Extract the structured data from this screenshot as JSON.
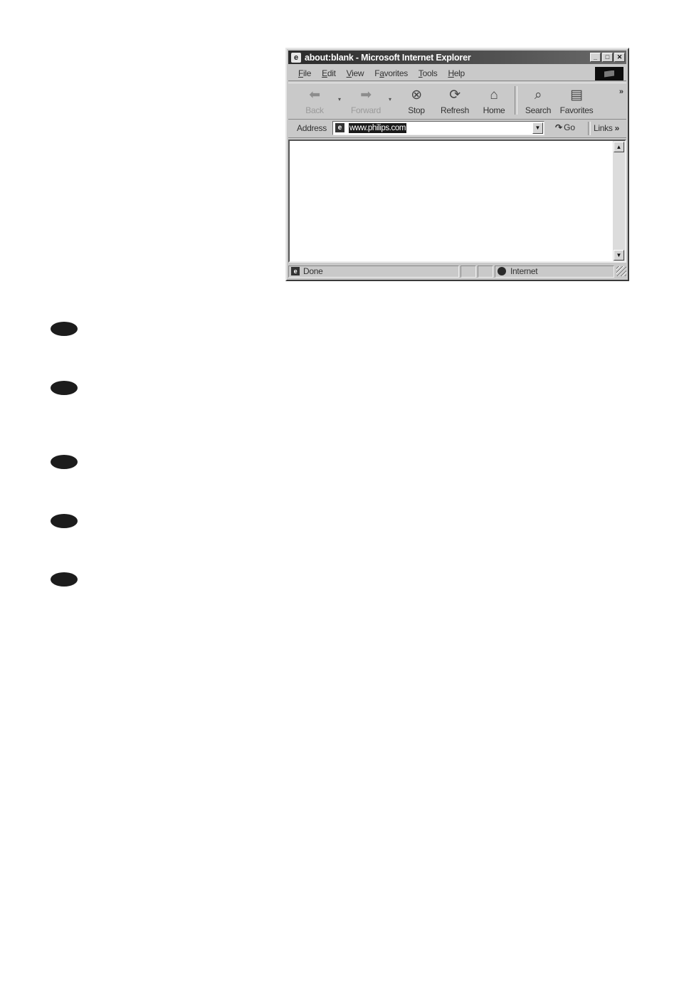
{
  "browser": {
    "title": "about:blank - Microsoft Internet Explorer",
    "title_icon": "e",
    "window_buttons": {
      "minimize": "_",
      "maximize": "□",
      "close": "✕"
    },
    "menu": [
      {
        "underlined": "F",
        "rest": "ile"
      },
      {
        "underlined": "E",
        "rest": "dit"
      },
      {
        "underlined": "V",
        "rest": "iew"
      },
      {
        "prefix": "F",
        "underlined": "a",
        "rest": "vorites"
      },
      {
        "underlined": "T",
        "rest": "ools"
      },
      {
        "underlined": "H",
        "rest": "elp"
      }
    ],
    "toolbar": {
      "back": "Back",
      "forward": "Forward",
      "stop": "Stop",
      "refresh": "Refresh",
      "home": "Home",
      "search": "Search",
      "favorites": "Favorites",
      "more": "»"
    },
    "address": {
      "label": "Address",
      "value": "www.philips.com",
      "go": "Go",
      "links": "Links",
      "links_more": "»"
    },
    "status": {
      "text": "Done",
      "zone": "Internet"
    }
  },
  "icons": {
    "back": "back-arrow-icon",
    "forward": "forward-arrow-icon",
    "stop": "stop-icon",
    "refresh": "refresh-icon",
    "home": "home-icon",
    "search": "search-icon",
    "favorites": "favorites-folder-icon"
  }
}
